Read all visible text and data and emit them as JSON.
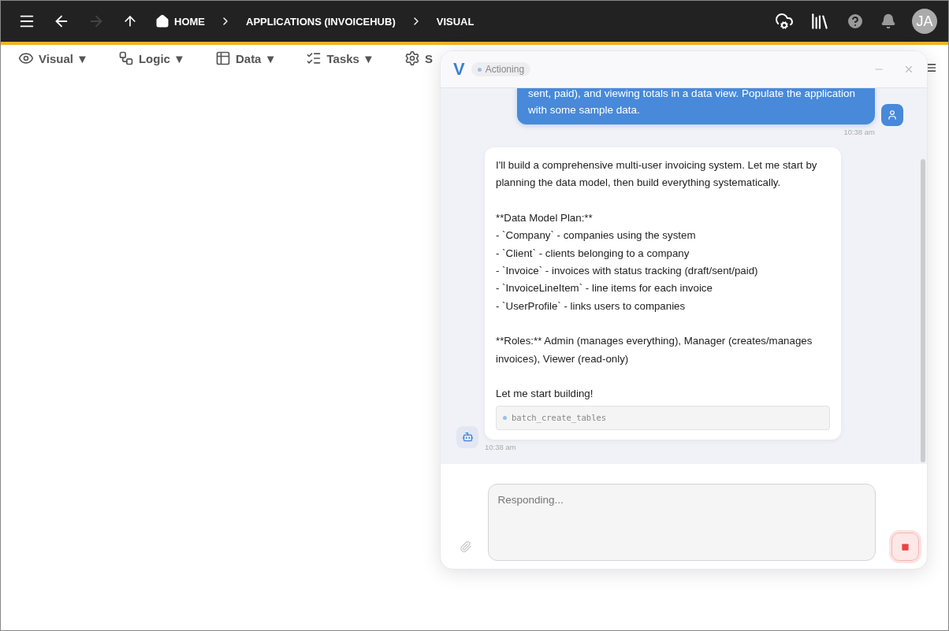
{
  "topbar": {
    "breadcrumbs": [
      {
        "label": "HOME",
        "kind": "home"
      },
      {
        "label": "APPLICATIONS (INVOICEHUB)",
        "kind": "plain"
      },
      {
        "label": "VISUAL",
        "kind": "plain"
      }
    ],
    "forward_disabled": true,
    "avatar": "JA"
  },
  "toolbar": [
    {
      "label": "Visual ▼",
      "kind": "eye"
    },
    {
      "label": "Logic ▼",
      "kind": "flow"
    },
    {
      "label": "Data ▼",
      "kind": "table"
    },
    {
      "label": "Tasks ▼",
      "kind": "tasks"
    },
    {
      "label": "S",
      "kind": "gear"
    }
  ],
  "chat": {
    "logo": "V",
    "status": "Actioning",
    "messages": [
      {
        "kind": "user",
        "paragraphs": [
          "sent, paid), and viewing totals in a data view. Populate the application with some sample data."
        ],
        "time": "10:38 am"
      },
      {
        "kind": "bot",
        "paragraphs": [
          "I'll build a comprehensive multi-user invoicing system. Let me start by planning the data model, then build everything systematically.",
          "**Data Model Plan:**\n- `Company` - companies using the system\n- `Client` - clients belonging to a company\n- `Invoice` - invoices with status tracking (draft/sent/paid)\n- `InvoiceLineItem` - line items for each invoice\n- `UserProfile` - links users to companies",
          "**Roles:** Admin (manages everything), Manager (creates/manages invoices), Viewer (read-only)",
          "Let me start building!"
        ],
        "tool": "batch_create_tables",
        "time": "10:38 am"
      }
    ],
    "input": {
      "placeholder": "Responding..."
    }
  }
}
